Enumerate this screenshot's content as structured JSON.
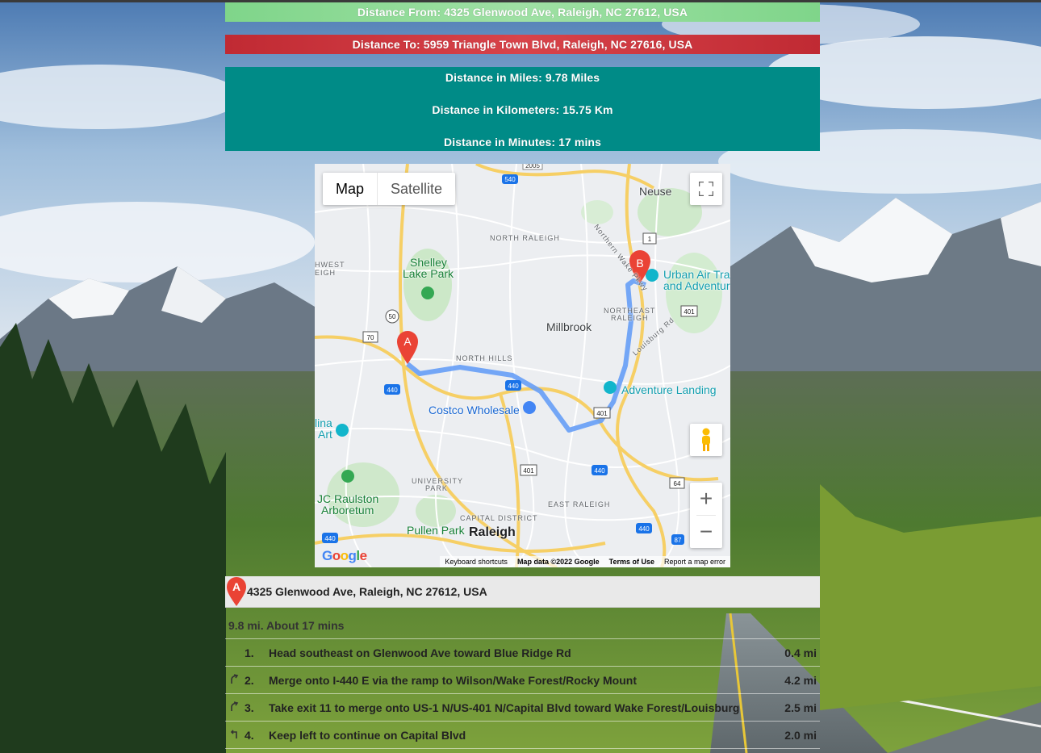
{
  "banners": {
    "from": "Distance From: 4325 Glenwood Ave, Raleigh, NC 27612, USA",
    "to": "Distance To: 5959 Triangle Town Blvd, Raleigh, NC 27616, USA",
    "miles": "Distance in Miles: 9.78 Miles",
    "km": "Distance in Kilometers: 15.75 Km",
    "minutes": "Distance in Minutes: 17 mins"
  },
  "map": {
    "type_map": "Map",
    "type_satellite": "Satellite",
    "zoom_in": "+",
    "zoom_out": "−",
    "footer": {
      "shortcuts": "Keyboard shortcuts",
      "data": "Map data ©2022 Google",
      "terms": "Terms of Use",
      "report": "Report a map error"
    },
    "marker_a": "A",
    "marker_b": "B",
    "labels": {
      "neuse": "Neuse",
      "north_raleigh": "NORTH RALEIGH",
      "shelley": "Shelley",
      "lake_park": "Lake Park",
      "hwest": "HWEST",
      "eigh": "EIGH",
      "urban_air": "Urban Air Tra",
      "and_adventur": "and Adventur",
      "northeast": "NORTHEAST",
      "raleigh_small": "RALEIGH",
      "millbrook": "Millbrook",
      "north_hills": "NORTH HILLS",
      "adventure_landing": "Adventure Landing",
      "costco": "Costco Wholesale",
      "lina": "lina",
      "art": "Art",
      "university": "UNIVERSITY",
      "park": "PARK",
      "jc_raulston": "JC Raulston",
      "arboretum": "Arboretum",
      "east_raleigh": "EAST RALEIGH",
      "capital_district": "CAPITAL DISTRICT",
      "pullen_park": "Pullen Park",
      "raleigh": "Raleigh",
      "northern_wake": "Northern Wake Pkwy",
      "louisburg_rd": "Louisburg Rd"
    },
    "route_badges": [
      "540",
      "2005",
      "1",
      "401",
      "50",
      "70",
      "440",
      "440",
      "401",
      "401",
      "440",
      "64",
      "440",
      "440",
      "87"
    ]
  },
  "directions": {
    "start_marker": "A",
    "start_address": "4325 Glenwood Ave, Raleigh, NC 27612, USA",
    "summary": "9.8 mi. About 17 mins",
    "steps": [
      {
        "icon": "",
        "num": "1.",
        "text": "Head southeast on Glenwood Ave toward Blue Ridge Rd",
        "dist": "0.4 mi"
      },
      {
        "icon": "merge-right-icon",
        "num": "2.",
        "text": "Merge onto I-440 E via the ramp to Wilson/Wake Forest/Rocky Mount",
        "dist": "4.2 mi"
      },
      {
        "icon": "merge-right-icon",
        "num": "3.",
        "text": "Take exit 11 to merge onto US-1 N/US-401 N/Capital Blvd toward Wake Forest/Louisburg",
        "dist": "2.5 mi"
      },
      {
        "icon": "keep-left-icon",
        "num": "4.",
        "text": "Keep left to continue on Capital Blvd",
        "dist": "2.0 mi"
      }
    ]
  },
  "colors": {
    "from_banner": "#8fdc98",
    "to_banner": "#cc3a40",
    "distance_box": "#008b87",
    "route": "#5a9bd5",
    "marker": "#ea4335"
  }
}
